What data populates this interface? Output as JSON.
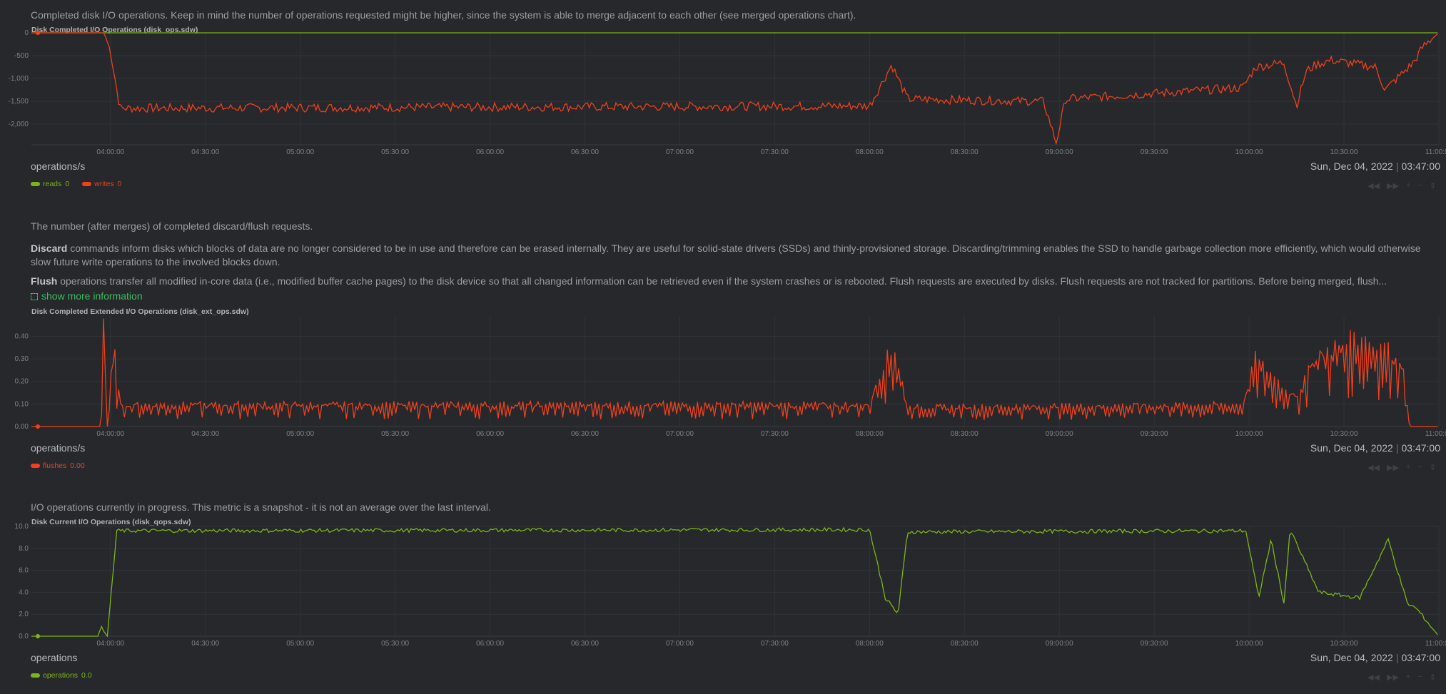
{
  "sections": [
    {
      "desc": "Completed disk I/O operations. Keep in mind the number of operations requested might be higher, since the system is able to merge adjacent to each other (see merged operations chart).",
      "title": "Disk Completed I/O Operations (disk_ops.sdw)",
      "units": "operations/s",
      "date": "Sun, Dec 04, 2022",
      "time": "03:47:00",
      "legend": [
        {
          "name": "reads",
          "value": "0",
          "color": "#7cb518"
        },
        {
          "name": "writes",
          "value": "0",
          "color": "#f0401c"
        }
      ]
    },
    {
      "desc_intro": "The number (after merges) of completed discard/flush requests.",
      "discard_label": "Discard",
      "discard_text": " commands inform disks which blocks of data are no longer considered to be in use and therefore can be erased internally. They are useful for solid-state drivers (SSDs) and thinly-provisioned storage. Discarding/trimming enables the SSD to handle garbage collection more efficiently, which would otherwise slow future write operations to the involved blocks down.",
      "flush_label": "Flush",
      "flush_text": " operations transfer all modified in-core data (i.e., modified buffer cache pages) to the disk device so that all changed information can be retrieved even if the system crashes or is rebooted. Flush requests are executed by disks. Flush requests are not tracked for partitions. Before being merged, flush...",
      "show_more": "show more information",
      "title": "Disk Completed Extended I/O Operations (disk_ext_ops.sdw)",
      "units": "operations/s",
      "date": "Sun, Dec 04, 2022",
      "time": "03:47:00",
      "legend": [
        {
          "name": "flushes",
          "value": "0.00",
          "color": "#f0401c"
        }
      ]
    },
    {
      "desc": "I/O operations currently in progress. This metric is a snapshot - it is not an average over the last interval.",
      "title": "Disk Current I/O Operations (disk_qops.sdw)",
      "units": "operations",
      "date": "Sun, Dec 04, 2022",
      "time": "03:47:00",
      "legend": [
        {
          "name": "operations",
          "value": "0.0",
          "color": "#7cb518"
        }
      ]
    }
  ],
  "toolbar_icons": [
    "pan-left-icon",
    "pan-right-icon",
    "zoom-in-icon",
    "zoom-out-icon",
    "resize-icon"
  ],
  "chart_data": [
    {
      "type": "line",
      "title": "Disk Completed I/O Operations (disk_ops.sdw)",
      "ylabel": "operations/s",
      "x_range": [
        "03:35:00",
        "11:00:00"
      ],
      "x_ticks": [
        "04:00:00",
        "04:30:00",
        "05:00:00",
        "05:30:00",
        "06:00:00",
        "06:30:00",
        "07:00:00",
        "07:30:00",
        "08:00:00",
        "08:30:00",
        "09:00:00",
        "09:30:00",
        "10:00:00",
        "10:30:00",
        "11:00:00"
      ],
      "y_ticks": [
        "0",
        "-500",
        "-1,000",
        "-1,500",
        "-2,000"
      ],
      "ylim": [
        -2450,
        0
      ],
      "grid": true,
      "series": [
        {
          "name": "reads",
          "color": "#7cb518",
          "x": [
            "03:35",
            "11:00"
          ],
          "values": [
            0,
            0
          ]
        },
        {
          "name": "writes",
          "color": "#f0401c",
          "x": [
            "03:35",
            "03:58",
            "04:00",
            "04:03",
            "08:00",
            "08:07",
            "08:12",
            "08:55",
            "08:59",
            "09:02",
            "09:58",
            "10:02",
            "10:11",
            "10:15",
            "10:18",
            "10:21",
            "10:26",
            "10:40",
            "10:43",
            "10:52",
            "10:55",
            "11:00"
          ],
          "values": [
            0,
            0,
            -400,
            -1650,
            -1600,
            -700,
            -1450,
            -1500,
            -2400,
            -1450,
            -1200,
            -750,
            -650,
            -1600,
            -850,
            -700,
            -600,
            -750,
            -1250,
            -650,
            -300,
            0
          ]
        }
      ]
    },
    {
      "type": "line",
      "title": "Disk Completed Extended I/O Operations (disk_ext_ops.sdw)",
      "ylabel": "operations/s",
      "x_range": [
        "03:35:00",
        "11:00:00"
      ],
      "x_ticks": [
        "04:00:00",
        "04:30:00",
        "05:00:00",
        "05:30:00",
        "06:00:00",
        "06:30:00",
        "07:00:00",
        "07:30:00",
        "08:00:00",
        "08:30:00",
        "09:00:00",
        "09:30:00",
        "10:00:00",
        "10:30:00",
        "11:00:00"
      ],
      "y_ticks": [
        "0.00",
        "0.10",
        "0.20",
        "0.30",
        "0.40"
      ],
      "ylim": [
        0,
        0.49
      ],
      "grid": true,
      "series": [
        {
          "name": "flushes",
          "color": "#f0401c",
          "x": [
            "03:35",
            "03:57",
            "03:58",
            "03:59",
            "04:01",
            "04:03",
            "08:00",
            "08:04",
            "08:08",
            "08:12",
            "09:58",
            "10:02",
            "10:15",
            "10:20",
            "10:35",
            "10:48",
            "10:51",
            "11:00"
          ],
          "values": [
            0,
            0,
            0.48,
            0,
            0.29,
            0.08,
            0.08,
            0.22,
            0.28,
            0.07,
            0.08,
            0.24,
            0.1,
            0.25,
            0.32,
            0.25,
            0,
            0
          ]
        }
      ]
    },
    {
      "type": "line",
      "title": "Disk Current I/O Operations (disk_qops.sdw)",
      "ylabel": "operations",
      "x_range": [
        "03:35:00",
        "11:00:00"
      ],
      "x_ticks": [
        "04:00:00",
        "04:30:00",
        "05:00:00",
        "05:30:00",
        "06:00:00",
        "06:30:00",
        "07:00:00",
        "07:30:00",
        "08:00:00",
        "08:30:00",
        "09:00:00",
        "09:30:00",
        "10:00:00",
        "10:30:00",
        "11:00:00"
      ],
      "y_ticks": [
        "0.0",
        "2.0",
        "4.0",
        "6.0",
        "8.0",
        "10.0"
      ],
      "ylim": [
        0,
        10
      ],
      "grid": true,
      "series": [
        {
          "name": "operations",
          "color": "#7cb518",
          "x": [
            "03:35",
            "03:56",
            "03:57",
            "03:59",
            "04:02",
            "08:00",
            "08:05",
            "08:09",
            "08:12",
            "09:59",
            "10:03",
            "10:07",
            "10:11",
            "10:13",
            "10:22",
            "10:35",
            "10:44",
            "10:50",
            "10:53",
            "11:00"
          ],
          "values": [
            0,
            0,
            0.8,
            0,
            9.6,
            9.7,
            3.5,
            2.0,
            9.5,
            9.6,
            3.5,
            8.8,
            3.0,
            9.7,
            4.0,
            3.5,
            8.8,
            3.0,
            2.5,
            0
          ]
        }
      ]
    }
  ]
}
